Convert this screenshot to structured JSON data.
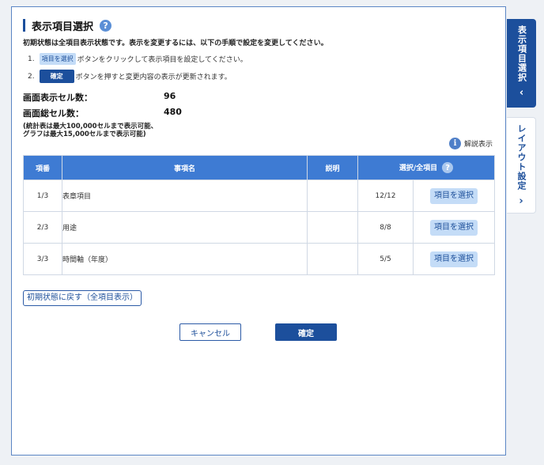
{
  "title": "表示項目選択",
  "intro": "初期状態は全項目表示状態です。表示を変更するには、以下の手順で設定を変更してください。",
  "steps": [
    {
      "num": "1.",
      "button": "項目を選択",
      "text": "ボタンをクリックして表示項目を設定してください。"
    },
    {
      "num": "2.",
      "button": "確定",
      "text": "ボタンを押すと変更内容の表示が更新されます。"
    }
  ],
  "counts": {
    "display_label": "画面表示セル数：",
    "display_value": "96",
    "total_label": "画面総セル数：",
    "total_value": "480"
  },
  "note": [
    "(統計表は最大100,000セルまで表示可能、",
    "グラフは最大15,000セルまで表示可能)"
  ],
  "info_label": "解説表示",
  "table": {
    "headers": {
      "no": "項番",
      "name": "事項名",
      "desc": "説明",
      "select": "選択/全項目"
    },
    "rows": [
      {
        "no": "1/3",
        "name": "表章項目",
        "desc": "",
        "count": "12/12",
        "button": "項目を選択"
      },
      {
        "no": "2/3",
        "name": "用途",
        "desc": "",
        "count": "8/8",
        "button": "項目を選択"
      },
      {
        "no": "3/3",
        "name": "時間軸（年度）",
        "desc": "",
        "count": "5/5",
        "button": "項目を選択"
      }
    ]
  },
  "reset_label": "初期状態に戻す（全項目表示）",
  "cancel_label": "キャンセル",
  "confirm_label": "確定",
  "side_tabs": [
    {
      "label": "表示項目選択",
      "chevron": "‹"
    },
    {
      "label": "レイアウト設定",
      "chevron": "›"
    }
  ],
  "colors": {
    "primary": "#1c4f9c",
    "header": "#3e7bd3",
    "light_button": "#c4dcf7"
  }
}
